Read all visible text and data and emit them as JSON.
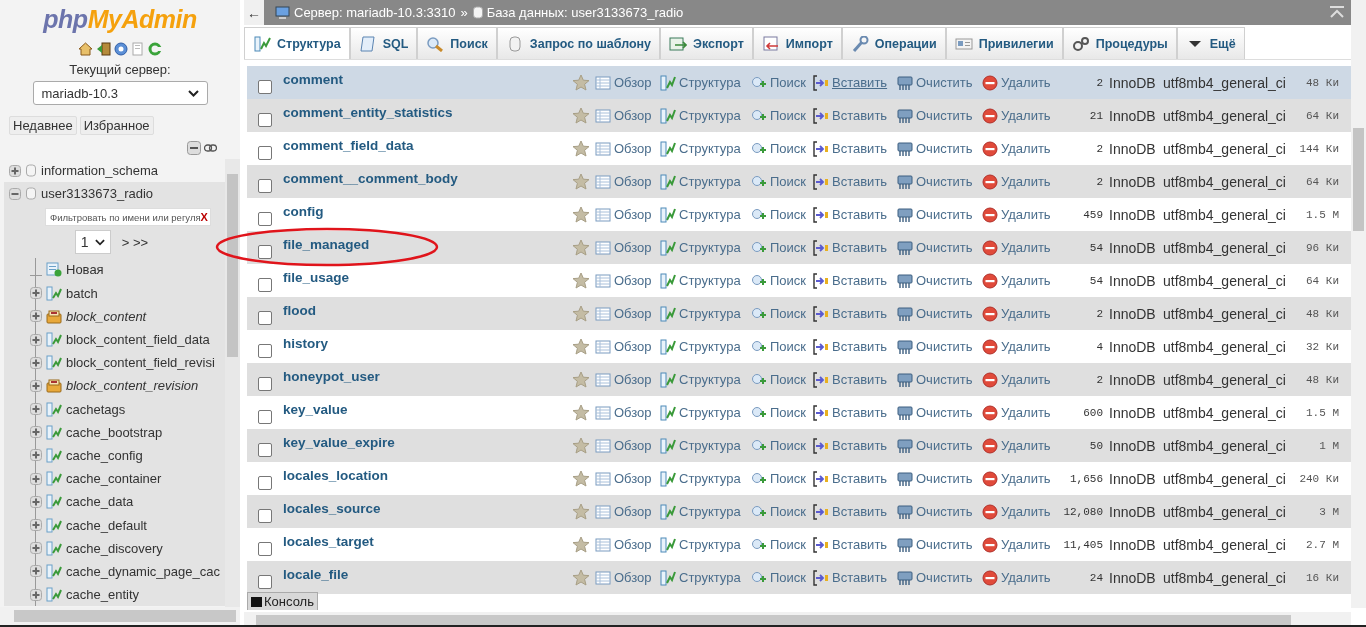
{
  "sidebar": {
    "logo": {
      "prefix": "php",
      "suffix": "MyAdmin"
    },
    "server_label": "Текущий сервер:",
    "server_select": "mariadb-10.3",
    "buttons": [
      "Недавнее",
      "Избранное"
    ],
    "tree": [
      {
        "name": "information_schema",
        "expanded": false
      },
      {
        "name": "user3133673_radio",
        "expanded": true,
        "filter_placeholder": "Фильтровать по имени или регуля",
        "filter_clear": "X",
        "page": "1",
        "pager": "> >>",
        "children": [
          {
            "kind": "new",
            "name": "Новая"
          },
          {
            "kind": "table",
            "name": "batch"
          },
          {
            "kind": "view",
            "name": "block_content"
          },
          {
            "kind": "table",
            "name": "block_content_field_data"
          },
          {
            "kind": "table",
            "name": "block_content_field_revisi"
          },
          {
            "kind": "view",
            "name": "block_content_revision"
          },
          {
            "kind": "table",
            "name": "cachetags"
          },
          {
            "kind": "table",
            "name": "cache_bootstrap"
          },
          {
            "kind": "table",
            "name": "cache_config"
          },
          {
            "kind": "table",
            "name": "cache_container"
          },
          {
            "kind": "table",
            "name": "cache_data"
          },
          {
            "kind": "table",
            "name": "cache_default"
          },
          {
            "kind": "table",
            "name": "cache_discovery"
          },
          {
            "kind": "table",
            "name": "cache_dynamic_page_cac"
          },
          {
            "kind": "table",
            "name": "cache_entity"
          }
        ]
      }
    ]
  },
  "breadcrumb": {
    "back": "←",
    "server": "Сервер: mariadb-10.3:3310",
    "separator": "»",
    "database": "База данных: user3133673_radio"
  },
  "tabs": [
    {
      "label": "Структура",
      "selected": true
    },
    {
      "label": "SQL",
      "selected": false
    },
    {
      "label": "Поиск",
      "selected": false
    },
    {
      "label": "Запрос по шаблону",
      "selected": false
    },
    {
      "label": "Экспорт",
      "selected": false
    },
    {
      "label": "Импорт",
      "selected": false
    },
    {
      "label": "Операции",
      "selected": false
    },
    {
      "label": "Привилегии",
      "selected": false
    },
    {
      "label": "Процедуры",
      "selected": false
    },
    {
      "label": "Ещё",
      "selected": false
    }
  ],
  "table": {
    "rows": [
      {
        "name": "comment",
        "checked": false,
        "highlighted": true,
        "circled": false,
        "actions": [
          "Обзор",
          "Структура",
          "Поиск",
          "Вставить",
          "Очистить",
          "Удалить"
        ],
        "rows": "2",
        "engine": "InnoDB",
        "collation": "utf8mb4_general_ci",
        "size": "48 Ки"
      },
      {
        "name": "comment_entity_statistics",
        "checked": false,
        "highlighted": false,
        "circled": false,
        "actions": [
          "Обзор",
          "Структура",
          "Поиск",
          "Вставить",
          "Очистить",
          "Удалить"
        ],
        "rows": "21",
        "engine": "InnoDB",
        "collation": "utf8mb4_general_ci",
        "size": "64 Ки"
      },
      {
        "name": "comment_field_data",
        "checked": false,
        "highlighted": false,
        "circled": false,
        "actions": [
          "Обзор",
          "Структура",
          "Поиск",
          "Вставить",
          "Очистить",
          "Удалить"
        ],
        "rows": "2",
        "engine": "InnoDB",
        "collation": "utf8mb4_general_ci",
        "size": "144 Ки"
      },
      {
        "name": "comment__comment_body",
        "checked": false,
        "highlighted": false,
        "circled": false,
        "actions": [
          "Обзор",
          "Структура",
          "Поиск",
          "Вставить",
          "Очистить",
          "Удалить"
        ],
        "rows": "2",
        "engine": "InnoDB",
        "collation": "utf8mb4_general_ci",
        "size": "64 Ки"
      },
      {
        "name": "config",
        "checked": false,
        "highlighted": false,
        "circled": false,
        "actions": [
          "Обзор",
          "Структура",
          "Поиск",
          "Вставить",
          "Очистить",
          "Удалить"
        ],
        "rows": "459",
        "engine": "InnoDB",
        "collation": "utf8mb4_general_ci",
        "size": "1.5 М"
      },
      {
        "name": "file_managed",
        "checked": false,
        "highlighted": false,
        "circled": true,
        "actions": [
          "Обзор",
          "Структура",
          "Поиск",
          "Вставить",
          "Очистить",
          "Удалить"
        ],
        "rows": "54",
        "engine": "InnoDB",
        "collation": "utf8mb4_general_ci",
        "size": "96 Ки"
      },
      {
        "name": "file_usage",
        "checked": false,
        "highlighted": false,
        "circled": false,
        "actions": [
          "Обзор",
          "Структура",
          "Поиск",
          "Вставить",
          "Очистить",
          "Удалить"
        ],
        "rows": "54",
        "engine": "InnoDB",
        "collation": "utf8mb4_general_ci",
        "size": "64 Ки"
      },
      {
        "name": "flood",
        "checked": false,
        "highlighted": false,
        "circled": false,
        "actions": [
          "Обзор",
          "Структура",
          "Поиск",
          "Вставить",
          "Очистить",
          "Удалить"
        ],
        "rows": "2",
        "engine": "InnoDB",
        "collation": "utf8mb4_general_ci",
        "size": "48 Ки"
      },
      {
        "name": "history",
        "checked": false,
        "highlighted": false,
        "circled": false,
        "actions": [
          "Обзор",
          "Структура",
          "Поиск",
          "Вставить",
          "Очистить",
          "Удалить"
        ],
        "rows": "4",
        "engine": "InnoDB",
        "collation": "utf8mb4_general_ci",
        "size": "32 Ки"
      },
      {
        "name": "honeypot_user",
        "checked": false,
        "highlighted": false,
        "circled": false,
        "actions": [
          "Обзор",
          "Структура",
          "Поиск",
          "Вставить",
          "Очистить",
          "Удалить"
        ],
        "rows": "2",
        "engine": "InnoDB",
        "collation": "utf8mb4_general_ci",
        "size": "48 Ки"
      },
      {
        "name": "key_value",
        "checked": false,
        "highlighted": false,
        "circled": false,
        "actions": [
          "Обзор",
          "Структура",
          "Поиск",
          "Вставить",
          "Очистить",
          "Удалить"
        ],
        "rows": "600",
        "engine": "InnoDB",
        "collation": "utf8mb4_general_ci",
        "size": "1.5 М"
      },
      {
        "name": "key_value_expire",
        "checked": false,
        "highlighted": false,
        "circled": false,
        "actions": [
          "Обзор",
          "Структура",
          "Поиск",
          "Вставить",
          "Очистить",
          "Удалить"
        ],
        "rows": "50",
        "engine": "InnoDB",
        "collation": "utf8mb4_general_ci",
        "size": "1 М"
      },
      {
        "name": "locales_location",
        "checked": false,
        "highlighted": false,
        "circled": false,
        "actions": [
          "Обзор",
          "Структура",
          "Поиск",
          "Вставить",
          "Очистить",
          "Удалить"
        ],
        "rows": "1,656",
        "engine": "InnoDB",
        "collation": "utf8mb4_general_ci",
        "size": "240 Ки"
      },
      {
        "name": "locales_source",
        "checked": false,
        "highlighted": false,
        "circled": false,
        "actions": [
          "Обзор",
          "Структура",
          "Поиск",
          "Вставить",
          "Очистить",
          "Удалить"
        ],
        "rows": "12,080",
        "engine": "InnoDB",
        "collation": "utf8mb4_general_ci",
        "size": "3 М"
      },
      {
        "name": "locales_target",
        "checked": false,
        "highlighted": false,
        "circled": false,
        "actions": [
          "Обзор",
          "Структура",
          "Поиск",
          "Вставить",
          "Очистить",
          "Удалить"
        ],
        "rows": "11,405",
        "engine": "InnoDB",
        "collation": "utf8mb4_general_ci",
        "size": "2.7 М"
      },
      {
        "name": "locale_file",
        "checked": false,
        "highlighted": false,
        "circled": false,
        "actions": [
          "Обзор",
          "Структура",
          "Поиск",
          "Вставить",
          "Очистить",
          "Удалить"
        ],
        "rows": "24",
        "engine": "InnoDB",
        "collation": "utf8mb4_general_ci",
        "size": "16 Ки"
      }
    ]
  },
  "console": "Консоль"
}
